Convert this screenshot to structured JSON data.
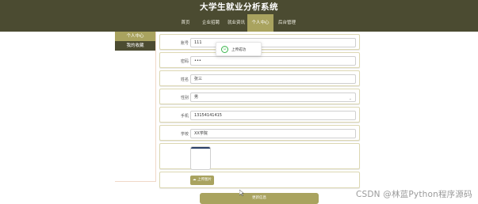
{
  "header": {
    "title": "大学生就业分析系统",
    "nav": [
      {
        "label": "首页",
        "active": false
      },
      {
        "label": "企业招聘",
        "active": false
      },
      {
        "label": "就业资讯",
        "active": false
      },
      {
        "label": "个人中心",
        "active": true
      },
      {
        "label": "后台管理",
        "active": false
      }
    ]
  },
  "sidebar": {
    "items": [
      {
        "label": "个人中心",
        "active": true
      },
      {
        "label": "我的收藏",
        "active": false
      }
    ]
  },
  "form": {
    "account": {
      "label": "账号",
      "value": "111"
    },
    "password": {
      "label": "密码",
      "value": "•••"
    },
    "name": {
      "label": "姓名",
      "value": "张三"
    },
    "gender": {
      "label": "性别",
      "value": "男"
    },
    "phone": {
      "label": "手机",
      "value": "13154141415"
    },
    "school": {
      "label": "学校",
      "value": "XX学院"
    },
    "avatar_icon": "profile-image-placeholder",
    "upload_label": "上传图片",
    "update_label": "更新信息"
  },
  "toast": {
    "icon": "smile-icon",
    "text": "上传成功"
  },
  "watermark": "CSDN @林蓝Python程序源码",
  "colors": {
    "header_bg": "#4b4b31",
    "accent": "#a9a35f",
    "success": "#39b54a"
  }
}
